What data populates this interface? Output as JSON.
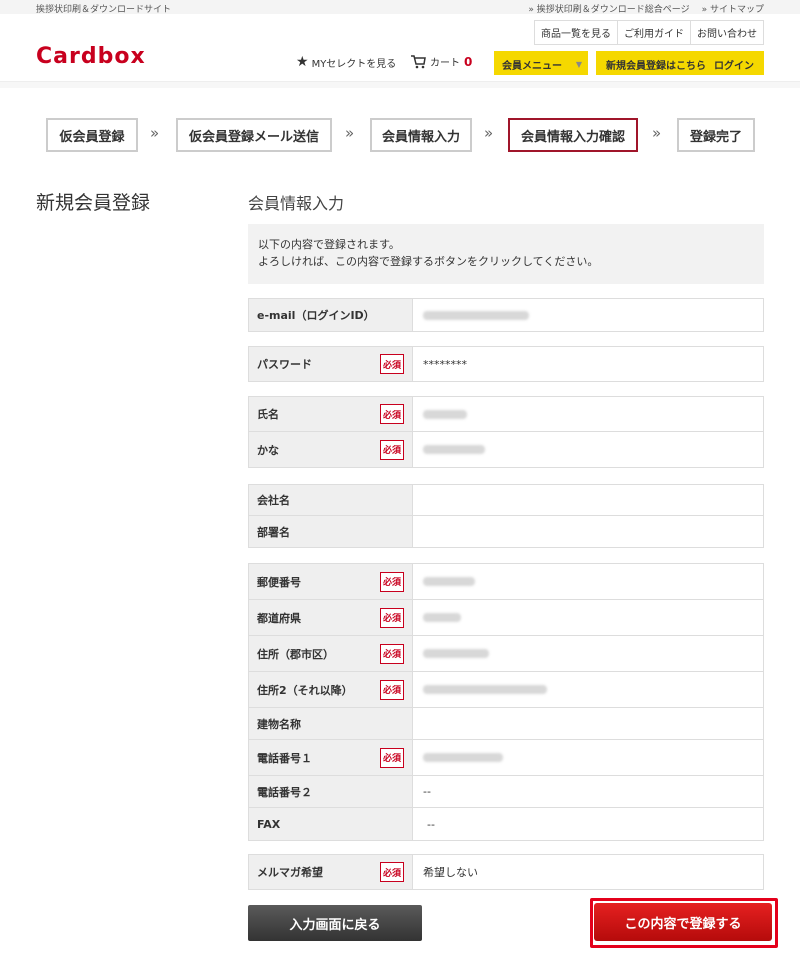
{
  "topbar": {
    "site_label": "挨拶状印刷＆ダウンロードサイト",
    "link1": "» 挨拶状印刷＆ダウンロード総合ページ",
    "link2": "» サイトマップ"
  },
  "header": {
    "logo": "Cardbox",
    "util_nav": [
      "商品一覧を見る",
      "ご利用ガイド",
      "お問い合わせ"
    ],
    "my_select": "MYセレクトを見る",
    "cart_label": "カート",
    "cart_count": "0",
    "member_menu": "会員メニュー",
    "register_link": "新規会員登録はこちら",
    "login_link": "ログイン"
  },
  "steps": [
    "仮会員登録",
    "仮会員登録メール送信",
    "会員情報入力",
    "会員情報入力確認",
    "登録完了"
  ],
  "step_arrow": "»",
  "page_title": "新規会員登録",
  "section_title": "会員情報入力",
  "notice": {
    "line1": "以下の内容で登録されます。",
    "line2": "よろしければ、この内容で登録するボタンをクリックしてください。"
  },
  "required_label": "必須",
  "form": {
    "email_label": "e-mail（ログインID）",
    "password_label": "パスワード",
    "password_value": "********",
    "name_label": "氏名",
    "kana_label": "かな",
    "company_label": "会社名",
    "dept_label": "部署名",
    "zip_label": "郵便番号",
    "pref_label": "都道府県",
    "addr1_label": "住所（郡市区）",
    "addr2_label": "住所2（それ以降）",
    "building_label": "建物名称",
    "tel1_label": "電話番号１",
    "tel2_label": "電話番号２",
    "tel2_value": "--",
    "fax_label": "FAX",
    "fax_value": "--",
    "mailmag_label": "メルマガ希望",
    "mailmag_value": "希望しない"
  },
  "buttons": {
    "back": "入力画面に戻る",
    "submit": "この内容で登録する"
  },
  "colors": {
    "brand_red": "#c8001e",
    "accent_yellow": "#f5d800",
    "active_step_border": "#a0152a"
  }
}
